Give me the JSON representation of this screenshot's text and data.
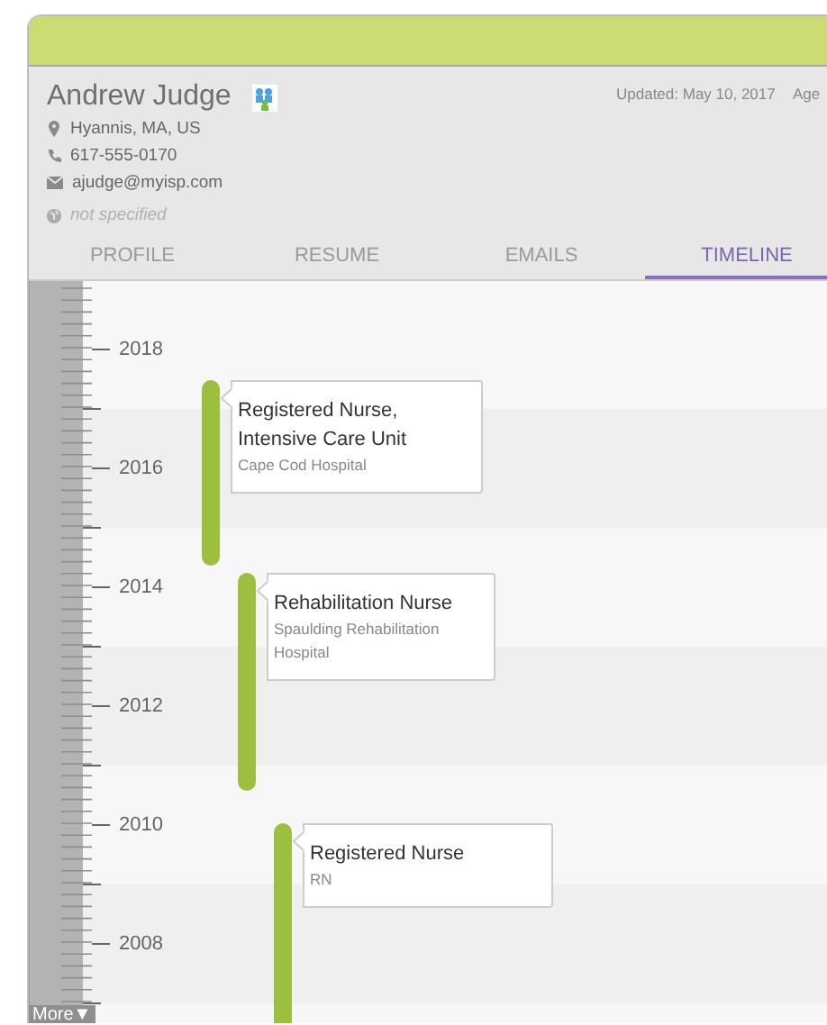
{
  "profile": {
    "name": "Andrew Judge",
    "location": "Hyannis, MA, US",
    "phone": "617-555-0170",
    "email": "ajudge@myisp.com",
    "website": "not specified",
    "updated": "Updated: May 10, 2017",
    "age_label": "Age"
  },
  "tabs": [
    {
      "label": "PROFILE",
      "selected": false
    },
    {
      "label": "RESUME",
      "selected": false
    },
    {
      "label": "EMAILS",
      "selected": false
    },
    {
      "label": "TIMELINE",
      "selected": true
    }
  ],
  "timeline": {
    "years": [
      "2018",
      "2016",
      "2014",
      "2012",
      "2010",
      "2008"
    ],
    "positions": [
      {
        "title": "Registered Nurse, Intensive Care Unit",
        "organization": "Cape Cod Hospital"
      },
      {
        "title": "Rehabilitation Nurse",
        "organization": "Spaulding Rehabilitation Hospital"
      },
      {
        "title": "Registered Nurse",
        "organization": "RN"
      }
    ],
    "more_label": "More",
    "more_arrow": "▼"
  }
}
